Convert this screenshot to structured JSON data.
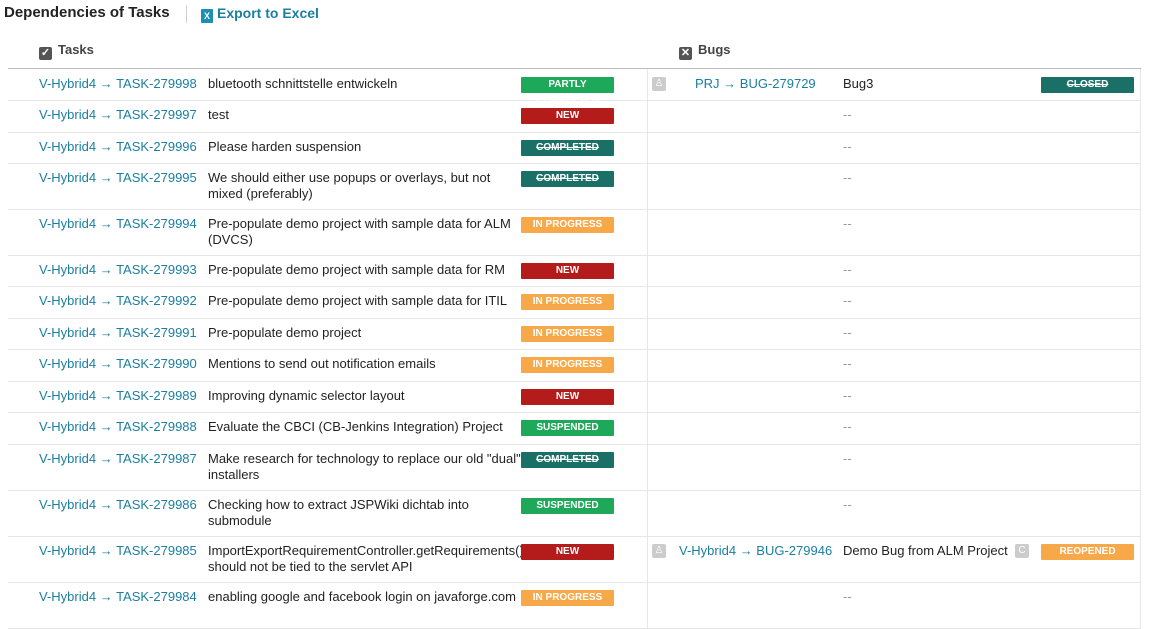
{
  "header": {
    "title": "Dependencies of Tasks",
    "export_label": "Export to Excel"
  },
  "columns": {
    "tasks": "Tasks",
    "bugs": "Bugs"
  },
  "rows": [
    {
      "task_id": "V-Hybrid4 → TASK-279998",
      "task_name": "bluetooth schnittstelle entwickeln",
      "task_status": "PARTLY COMPLETED",
      "bug_id": "PRJ → BUG-279729",
      "bug_name": "Bug3",
      "bug_status": "CLOSED",
      "dash": ""
    },
    {
      "task_id": "V-Hybrid4 → TASK-279997",
      "task_name": "test",
      "task_status": "NEW",
      "dash": "--"
    },
    {
      "task_id": "V-Hybrid4 → TASK-279996",
      "task_name": "Please harden suspension",
      "task_status": "COMPLETED",
      "dash": "--"
    },
    {
      "task_id": "V-Hybrid4 → TASK-279995",
      "task_name": "We should either use popups or overlays, but not mixed (preferably)",
      "task_status": "COMPLETED",
      "dash": "--"
    },
    {
      "task_id": "V-Hybrid4 → TASK-279994",
      "task_name": "Pre-populate demo project with sample data for ALM (DVCS)",
      "task_status": "IN PROGRESS",
      "dash": "--"
    },
    {
      "task_id": "V-Hybrid4 → TASK-279993",
      "task_name": "Pre-populate demo project with sample data for RM",
      "task_status": "NEW",
      "dash": "--"
    },
    {
      "task_id": "V-Hybrid4 → TASK-279992",
      "task_name": "Pre-populate demo project with sample data for ITIL",
      "task_status": "IN PROGRESS",
      "dash": "--"
    },
    {
      "task_id": "V-Hybrid4 → TASK-279991",
      "task_name": "Pre-populate demo project",
      "task_status": "IN PROGRESS",
      "dash": "--"
    },
    {
      "task_id": "V-Hybrid4 → TASK-279990",
      "task_name": "Mentions to send out notification emails",
      "task_status": "IN PROGRESS",
      "dash": "--"
    },
    {
      "task_id": "V-Hybrid4 → TASK-279989",
      "task_name": "Improving dynamic selector layout",
      "task_status": "NEW",
      "dash": "--"
    },
    {
      "task_id": "V-Hybrid4 → TASK-279988",
      "task_name": "Evaluate the CBCI (CB-Jenkins Integration) Project",
      "task_status": "SUSPENDED",
      "dash": "--"
    },
    {
      "task_id": "V-Hybrid4 → TASK-279987",
      "task_name": "Make research for technology to replace our old \"dual\" installers",
      "task_status": "COMPLETED",
      "dash": "--"
    },
    {
      "task_id": "V-Hybrid4 → TASK-279986",
      "task_name": "Checking how to extract JSPWiki dichtab into submodule",
      "task_status": "SUSPENDED",
      "dash": "--"
    },
    {
      "task_id": "V-Hybrid4 → TASK-279985",
      "task_name": "ImportExportRequirementController.getRequirements() should not be tied to the servlet API",
      "task_status": "NEW",
      "bug_id": "V-Hybrid4 → BUG-279946",
      "bug_name": "Demo Bug from ALM Project",
      "bug_status": "REOPENED",
      "dash": ""
    },
    {
      "task_id": "V-Hybrid4 → TASK-279984",
      "task_name": "enabling google and facebook login on javaforge.com",
      "task_status": "IN PROGRESS",
      "dash": "--"
    }
  ],
  "status_colors": {
    "PARTLY COMPLETED": "#1ea85a",
    "NEW": "#b41c1c",
    "COMPLETED": "#1a7067",
    "IN PROGRESS": "#f7a94a",
    "SUSPENDED": "#1ea85a",
    "CLOSED": "#1a7067",
    "REOPENED": "#f7a94a"
  },
  "icons": {
    "export": "excel-icon",
    "tasks": "checkbox-icon",
    "bugs": "bug-icon",
    "user": "user-icon"
  }
}
